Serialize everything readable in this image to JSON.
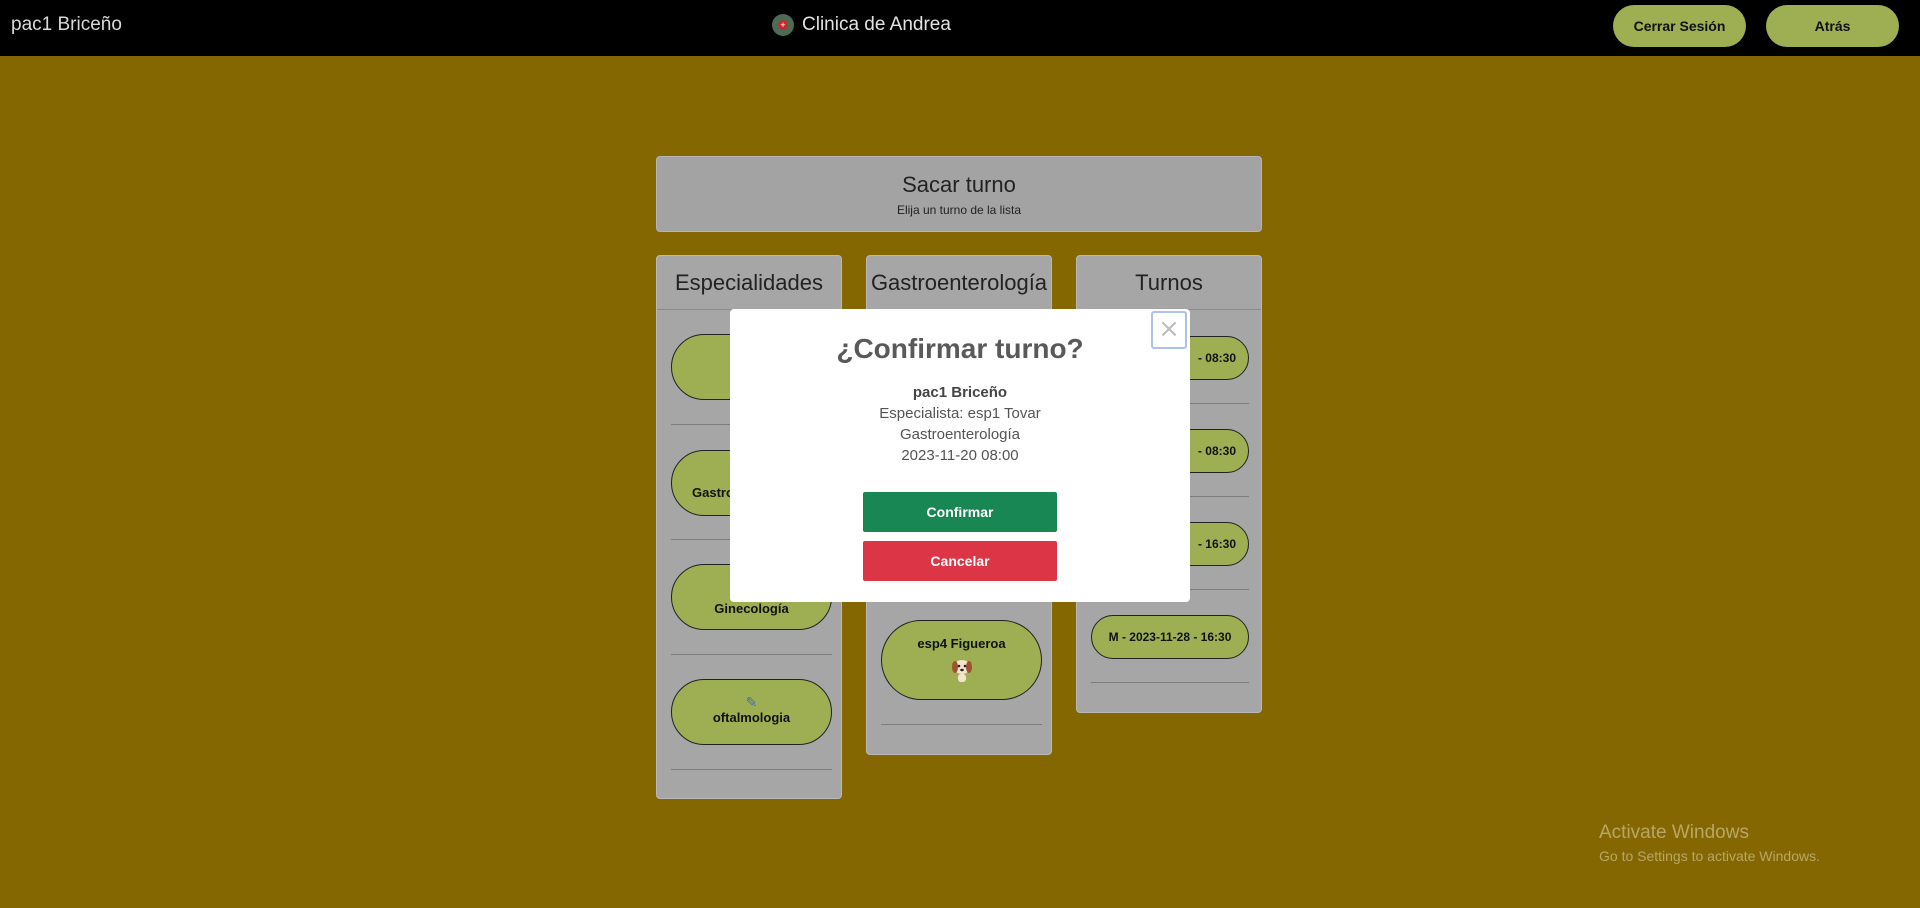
{
  "navbar": {
    "user": "pac1 Briceño",
    "brand": "Clinica de Andrea",
    "logout_label": "Cerrar Sesión",
    "back_label": "Atrás"
  },
  "header": {
    "title": "Sacar turno",
    "subtitle": "Elija un turno de la lista"
  },
  "especialidades": {
    "title": "Especialidades",
    "items": [
      "",
      "Gastroenterología",
      "Ginecología",
      "oftalmologia"
    ]
  },
  "especialistas": {
    "title": "Gastroenterología",
    "items": [
      "esp4 Figueroa"
    ]
  },
  "turnos": {
    "title": "Turnos",
    "items": [
      "- 08:30",
      "- 08:30",
      "- 16:30",
      "M - 2023-11-28 - 16:30"
    ]
  },
  "modal": {
    "title": "¿Confirmar turno?",
    "patient": "pac1 Briceño",
    "specialist": "Especialista: esp1 Tovar",
    "specialty": "Gastroenterología",
    "datetime": "2023-11-20 08:00",
    "confirm_label": "Confirmar",
    "cancel_label": "Cancelar",
    "close_symbol": "×"
  },
  "watermark": {
    "line1": "Activate Windows",
    "line2": "Go to Settings to activate Windows."
  },
  "colors": {
    "background": "#846700",
    "pill": "#9eae52",
    "confirm": "#198754",
    "cancel": "#dc3545"
  }
}
